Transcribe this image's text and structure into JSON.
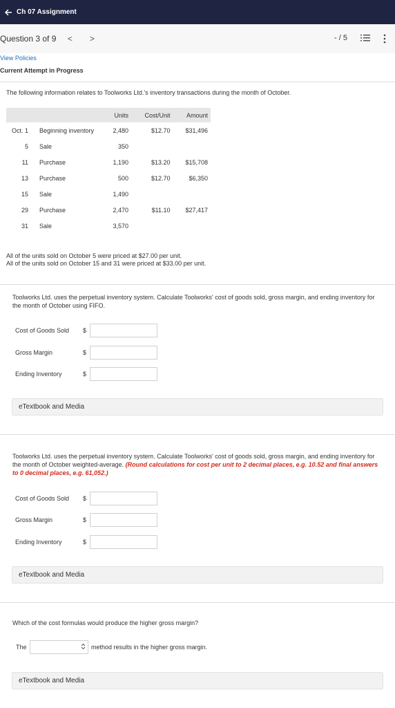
{
  "header": {
    "title": "Ch 07 Assignment"
  },
  "question_bar": {
    "label": "Question 3 of 9",
    "prev": "<",
    "next": ">",
    "score": "- / 5"
  },
  "policies_link": "View Policies",
  "attempt_status": "Current Attempt in Progress",
  "intro": "The following information relates to Toolworks Ltd.'s inventory transactions during the month of October.",
  "table": {
    "headers": {
      "units": "Units",
      "cost": "Cost/Unit",
      "amount": "Amount"
    },
    "rows": [
      {
        "date": "Oct. 1",
        "desc": "Beginning inventory",
        "units": "2,480",
        "cost": "$12.70",
        "amount": "$31,496"
      },
      {
        "date": "5",
        "desc": "Sale",
        "units": "350",
        "cost": "",
        "amount": ""
      },
      {
        "date": "11",
        "desc": "Purchase",
        "units": "1,190",
        "cost": "$13.20",
        "amount": "$15,708"
      },
      {
        "date": "13",
        "desc": "Purchase",
        "units": "500",
        "cost": "$12.70",
        "amount": "$6,350"
      },
      {
        "date": "15",
        "desc": "Sale",
        "units": "1,490",
        "cost": "",
        "amount": ""
      },
      {
        "date": "29",
        "desc": "Purchase",
        "units": "2,470",
        "cost": "$11.10",
        "amount": "$27,417"
      },
      {
        "date": "31",
        "desc": "Sale",
        "units": "3,570",
        "cost": "",
        "amount": ""
      }
    ]
  },
  "notes": [
    "All of the units sold on October 5 were priced at $27.00 per unit.",
    "All of the units sold on October 15 and 31 were priced at $33.00 per unit."
  ],
  "part1": {
    "text": "Toolworks Ltd. uses the perpetual inventory system. Calculate Toolworks' cost of goods sold, gross margin, and ending inventory for the month of October using FIFO.",
    "fields": [
      {
        "label": "Cost of Goods Sold",
        "currency": "$",
        "value": ""
      },
      {
        "label": "Gross Margin",
        "currency": "$",
        "value": ""
      },
      {
        "label": "Ending Inventory",
        "currency": "$",
        "value": ""
      }
    ],
    "etext": "eTextbook and Media"
  },
  "part2": {
    "text": "Toolworks Ltd. uses the perpetual inventory system. Calculate Toolworks' cost of goods sold, gross margin, and ending inventory for the month of October weighted-average.",
    "warning": "(Round calculations for cost per unit to 2 decimal places, e.g. 10.52 and final answers to 0 decimal places, e.g. 61,052.)",
    "fields": [
      {
        "label": "Cost of Goods Sold",
        "currency": "$",
        "value": ""
      },
      {
        "label": "Gross Margin",
        "currency": "$",
        "value": ""
      },
      {
        "label": "Ending Inventory",
        "currency": "$",
        "value": ""
      }
    ],
    "etext": "eTextbook and Media"
  },
  "part3": {
    "question": "Which of the cost formulas would produce the higher gross margin?",
    "prefix": "The",
    "selected": "",
    "suffix": "method results in the higher gross margin.",
    "etext": "eTextbook and Media"
  },
  "icons": {
    "back": "arrow-left-icon",
    "list": "list-icon",
    "more": "more-vertical-icon",
    "select_caret": "chevron-updown-icon"
  },
  "colors": {
    "header_bg": "#1f2442",
    "link": "#1e6fb8",
    "warning": "#d42a1e"
  }
}
